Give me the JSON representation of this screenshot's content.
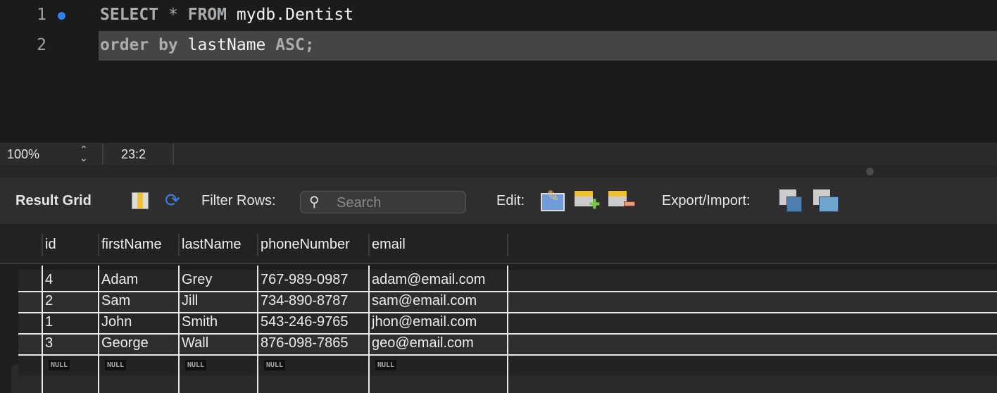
{
  "editor": {
    "lines": [
      {
        "number": "1",
        "keyword1": "SELECT",
        "op": " * ",
        "keyword2": "FROM",
        "rest": " mydb.Dentist"
      },
      {
        "number": "2",
        "keyword1": "order by",
        "rest": " lastName ",
        "keyword2": "ASC;"
      }
    ],
    "breakpoint_color": "#2f80ed"
  },
  "status": {
    "zoom": "100%",
    "cursor": "23:2"
  },
  "toolbar": {
    "result_grid": "Result Grid",
    "filter_rows": "Filter Rows:",
    "search_placeholder": "Search",
    "edit": "Edit:",
    "export_import": "Export/Import:"
  },
  "grid": {
    "columns": [
      "id",
      "firstName",
      "lastName",
      "phoneNumber",
      "email"
    ],
    "rows": [
      [
        "4",
        "Adam",
        "Grey",
        "767-989-0987",
        "adam@email.com"
      ],
      [
        "2",
        "Sam",
        "Jill",
        "734-890-8787",
        "sam@email.com"
      ],
      [
        "1",
        "John",
        "Smith",
        "543-246-9765",
        "jhon@email.com"
      ],
      [
        "3",
        "George",
        "Wall",
        "876-098-7865",
        "geo@email.com"
      ]
    ],
    "null_label": "NULL"
  }
}
